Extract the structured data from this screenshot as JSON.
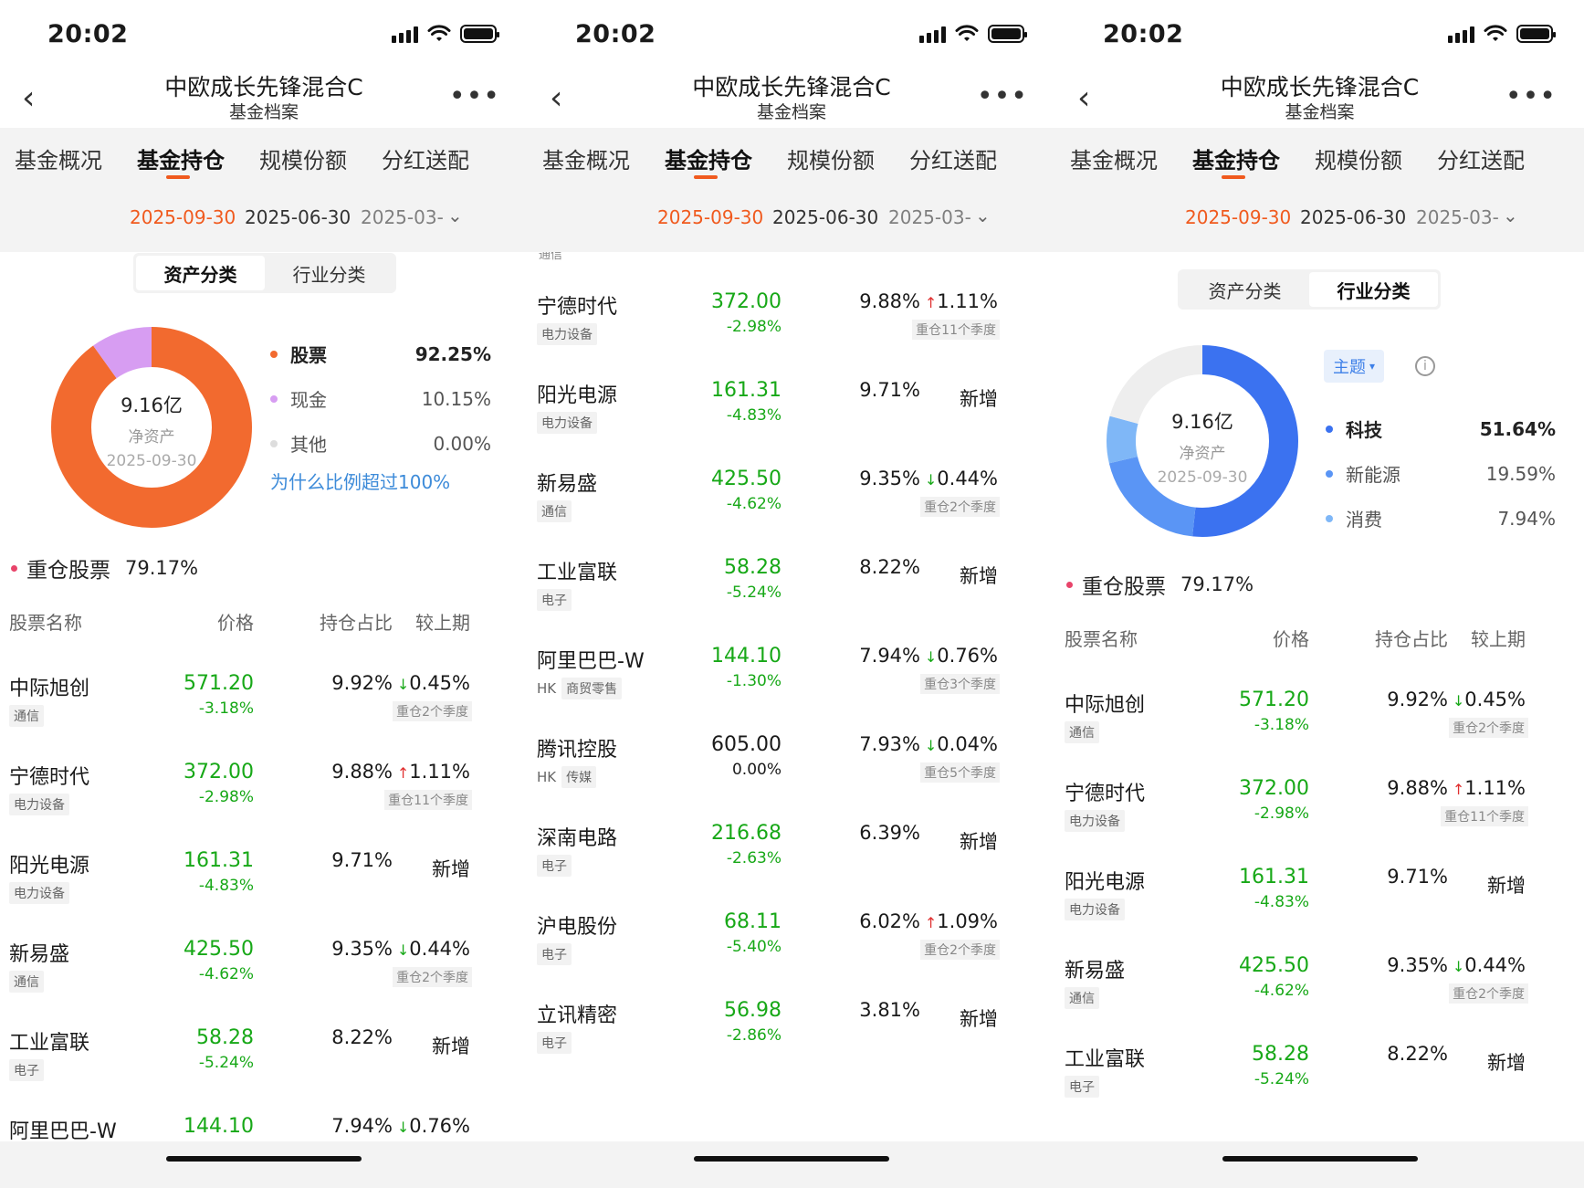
{
  "status_time": "20:02",
  "nav": {
    "title": "中欧成长先锋混合C",
    "subtitle": "基金档案",
    "back": "‹",
    "more": "•••"
  },
  "tabs": [
    "基金概况",
    "基金持仓",
    "规模份额",
    "分红送配"
  ],
  "dates": [
    "2025-09-30",
    "2025-06-30",
    "2025-03-"
  ],
  "seg": [
    "资产分类",
    "行业分类"
  ],
  "donut_center": {
    "value": "9.16亿",
    "label": "净资产",
    "date": "2025-09-30"
  },
  "asset_legend": [
    {
      "name": "股票",
      "value": "92.25%",
      "color": "#f26a2f"
    },
    {
      "name": "现金",
      "value": "10.15%",
      "color": "#d79df2"
    },
    {
      "name": "其他",
      "value": "0.00%",
      "color": "#dddddd"
    }
  ],
  "asset_chart": {
    "type": "pie",
    "categories": [
      "股票",
      "现金",
      "其他"
    ],
    "values": [
      92.25,
      10.15,
      0.0
    ]
  },
  "why_link": "为什么比例超过100%",
  "industry_theme_btn": "主题",
  "industry_legend": [
    {
      "name": "科技",
      "value": "51.64%",
      "color": "#3b72f0"
    },
    {
      "name": "新能源",
      "value": "19.59%",
      "color": "#5a95f5"
    },
    {
      "name": "消费",
      "value": "7.94%",
      "color": "#7fb7f7"
    }
  ],
  "industry_chart": {
    "type": "pie",
    "categories": [
      "科技",
      "新能源",
      "消费"
    ],
    "values": [
      51.64,
      19.59,
      7.94
    ]
  },
  "holdings_head": {
    "title": "重仓股票",
    "value": "79.17%"
  },
  "columns": [
    "股票名称",
    "价格",
    "持仓占比",
    "较上期"
  ],
  "partial_tag": "通信",
  "partial_row": {
    "name": "阿里巴巴-W",
    "price": "144.10",
    "pct": "7.94%",
    "delta": "0.76%"
  },
  "holdings": [
    {
      "name": "中际旭创",
      "mkt": "",
      "tag": "通信",
      "price": "571.20",
      "chg": "-3.18%",
      "pct": "9.92%",
      "dir": "down",
      "delta": "0.45%",
      "quarter": "重仓2个季度"
    },
    {
      "name": "宁德时代",
      "mkt": "",
      "tag": "电力设备",
      "price": "372.00",
      "chg": "-2.98%",
      "pct": "9.88%",
      "dir": "up",
      "delta": "1.11%",
      "quarter": "重仓11个季度"
    },
    {
      "name": "阳光电源",
      "mkt": "",
      "tag": "电力设备",
      "price": "161.31",
      "chg": "-4.83%",
      "pct": "9.71%",
      "dir": "new",
      "delta": "新增",
      "quarter": ""
    },
    {
      "name": "新易盛",
      "mkt": "",
      "tag": "通信",
      "price": "425.50",
      "chg": "-4.62%",
      "pct": "9.35%",
      "dir": "down",
      "delta": "0.44%",
      "quarter": "重仓2个季度"
    },
    {
      "name": "工业富联",
      "mkt": "",
      "tag": "电子",
      "price": "58.28",
      "chg": "-5.24%",
      "pct": "8.22%",
      "dir": "new",
      "delta": "新增",
      "quarter": ""
    },
    {
      "name": "阿里巴巴-W",
      "mkt": "HK",
      "tag": "商贸零售",
      "price": "144.10",
      "chg": "-1.30%",
      "pct": "7.94%",
      "dir": "down",
      "delta": "0.76%",
      "quarter": "重仓3个季度"
    },
    {
      "name": "腾讯控股",
      "mkt": "HK",
      "tag": "传媒",
      "price": "605.00",
      "chg": "0.00%",
      "pct": "7.93%",
      "dir": "down",
      "delta": "0.04%",
      "quarter": "重仓5个季度"
    },
    {
      "name": "深南电路",
      "mkt": "",
      "tag": "电子",
      "price": "216.68",
      "chg": "-2.63%",
      "pct": "6.39%",
      "dir": "new",
      "delta": "新增",
      "quarter": ""
    },
    {
      "name": "沪电股份",
      "mkt": "",
      "tag": "电子",
      "price": "68.11",
      "chg": "-5.40%",
      "pct": "6.02%",
      "dir": "up",
      "delta": "1.09%",
      "quarter": "重仓2个季度"
    },
    {
      "name": "立讯精密",
      "mkt": "",
      "tag": "电子",
      "price": "56.98",
      "chg": "-2.86%",
      "pct": "3.81%",
      "dir": "new",
      "delta": "新增",
      "quarter": ""
    }
  ]
}
